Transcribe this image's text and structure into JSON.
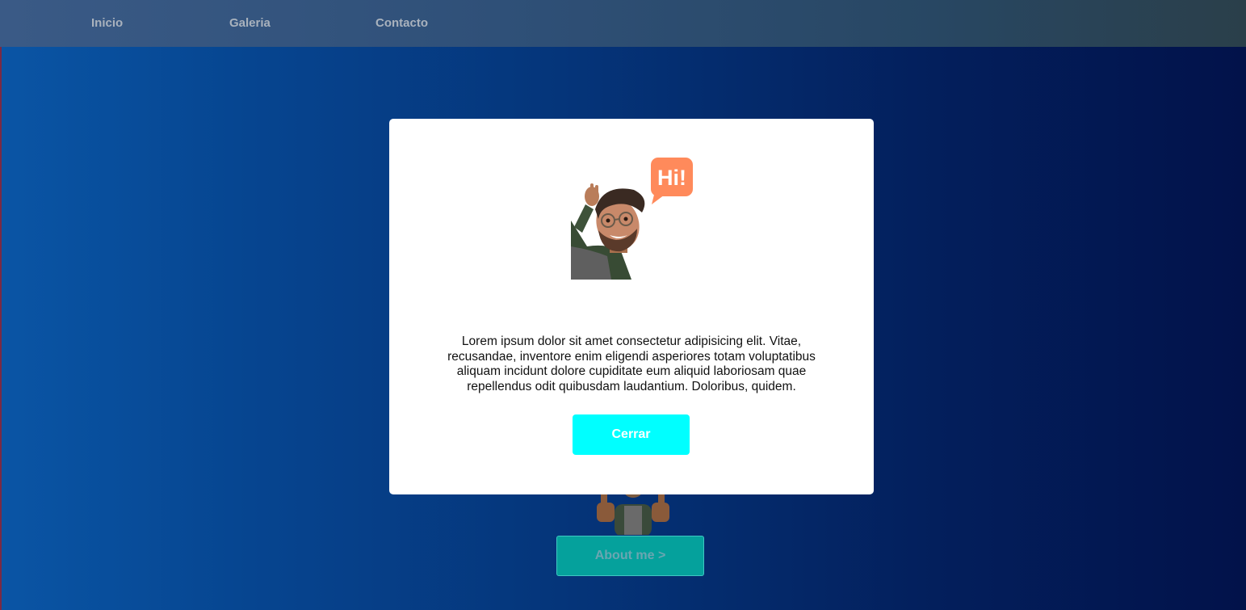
{
  "nav": {
    "items": [
      {
        "label": "Inicio"
      },
      {
        "label": "Galeria"
      },
      {
        "label": "Contacto"
      }
    ]
  },
  "modal": {
    "speech_bubble_text": "Hi!",
    "body_text": "Lorem ipsum dolor sit amet consectetur adipisicing elit. Vitae, recusandae, inventore enim eligendi asperiores totam voluptatibus aliquam incidunt dolore cupiditate eum aliquid laboriosam quae repellendus odit quibusdam laudantium. Doloribus, quidem.",
    "close_label": "Cerrar"
  },
  "page": {
    "about_label": "About me >"
  },
  "colors": {
    "accent_cyan": "#00ffff",
    "about_button": "#05a19c",
    "bubble": "#ff8a5b"
  },
  "icons": [
    "waving-avatar-icon",
    "speech-bubble-icon",
    "thumbs-up-avatar-icon"
  ]
}
